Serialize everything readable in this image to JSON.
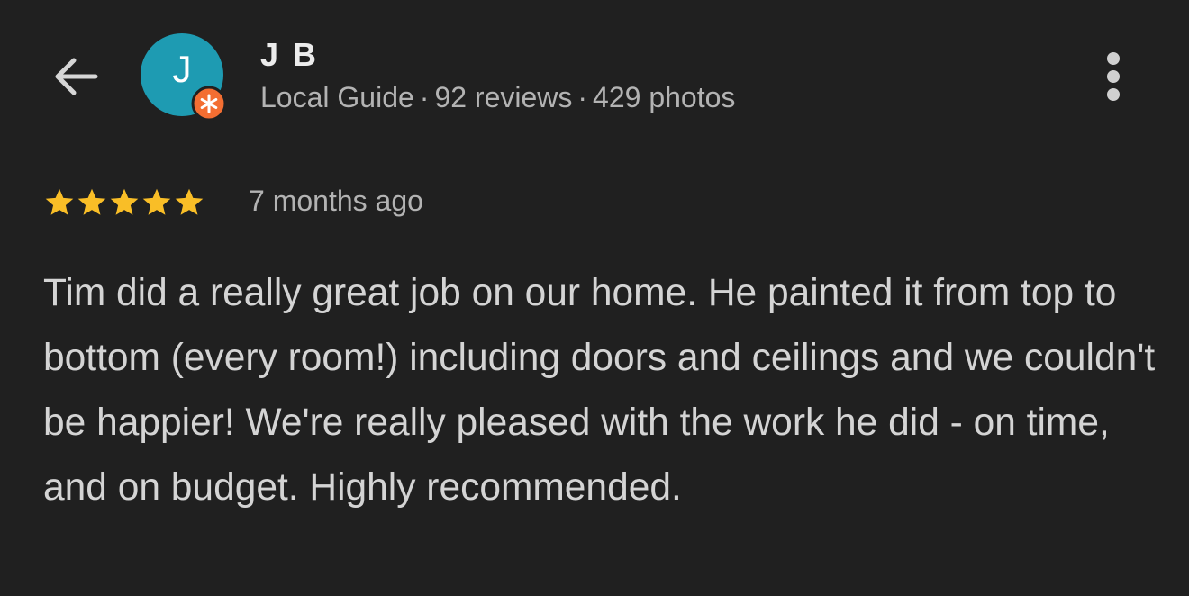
{
  "reviewer": {
    "name": "J B",
    "avatar_initial": "J",
    "avatar_color": "#1e9bb2",
    "badge_icon": "local-guide-badge-icon",
    "badge_color": "#f36e32",
    "level": "Local Guide",
    "reviews": "92 reviews",
    "photos": "429 photos",
    "separator": "·"
  },
  "toolbar": {
    "back_icon": "arrow-left-icon",
    "more_icon": "more-vert-icon"
  },
  "review": {
    "rating": 5,
    "rating_max": 5,
    "star_color": "#f9be27",
    "time": "7 months ago",
    "text": "Tim did a really great job on our home. He painted it from top to bottom (every room!) including doors and ceilings and we couldn't be happier! We're really pleased with the work he did - on time, and on budget. Highly recommended."
  }
}
